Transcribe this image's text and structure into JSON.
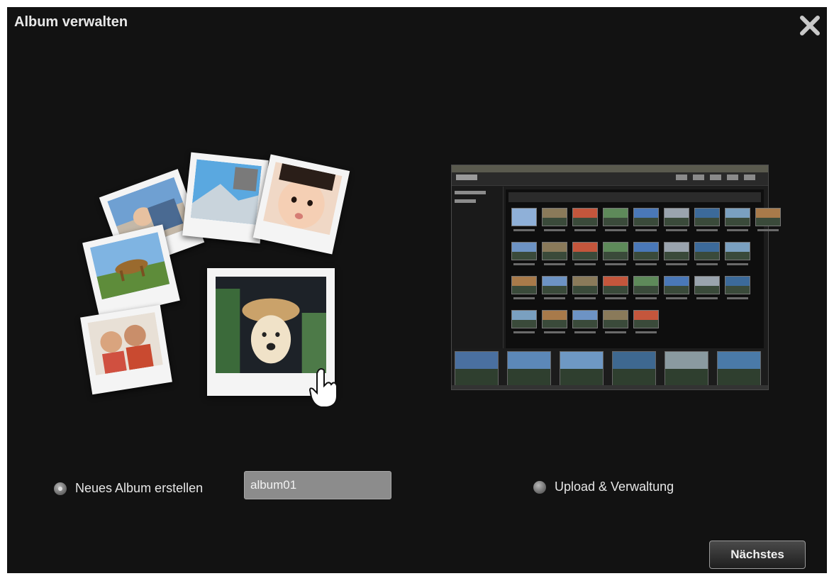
{
  "dialog": {
    "title": "Album verwalten",
    "close_icon": "close-icon"
  },
  "options": {
    "new_album": {
      "label": "Neues Album erstellen",
      "selected": true
    },
    "album_name": {
      "value": "album01"
    },
    "upload": {
      "label": "Upload & Verwaltung",
      "selected": false
    }
  },
  "footer": {
    "next_label": "Nächstes"
  },
  "colors": {
    "background": "#121212",
    "text": "#e6e6e6",
    "input_bg": "#8c8c8c"
  }
}
